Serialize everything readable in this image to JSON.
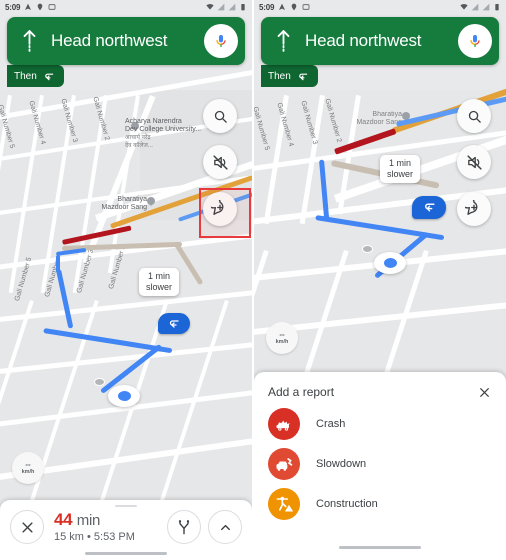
{
  "statusbar": {
    "time": "5:09",
    "left_icons": [
      "navigation-arrow-icon",
      "location-pin-icon",
      "screenshot-icon"
    ],
    "right_icons": [
      "wifi-icon",
      "signal-icon",
      "signal-icon",
      "battery-icon"
    ]
  },
  "nav_header": {
    "direction_icon": "arrow-up-icon",
    "instruction": "Head northwest",
    "mic_icon": "microphone-icon",
    "then_label": "Then",
    "then_icon": "turn-left-icon",
    "green": "#167c3e",
    "then_green": "#0f6631"
  },
  "map_buttons": [
    {
      "name": "search-button",
      "icon": "search-icon"
    },
    {
      "name": "mute-button",
      "icon": "volume-off-icon"
    },
    {
      "name": "add-report-button",
      "icon": "report-bubble-plus-icon"
    }
  ],
  "highlight": {
    "color": "#e8393c",
    "target": "add-report-button"
  },
  "map": {
    "callout": {
      "line1": "1 min",
      "line2": "slower"
    },
    "turn_marker_icon": "u-turn-left-icon",
    "pois": [
      {
        "name": "Acharya Narendra",
        "line2": "Dev College University...",
        "line3": "आचार्य नरेंद्र",
        "line4": "देव कॉलेज..."
      },
      {
        "name": "Bharatiya",
        "line2": "Mazdoor Sang"
      }
    ],
    "streets": [
      "Gali Number 2",
      "Gali Number 3",
      "Gali Number 4",
      "Gali Number 5",
      "Gali Number 2",
      "Gali Number 3",
      "Gali Number 4",
      "Gali Number 5"
    ],
    "route_color": "#4285f4",
    "alt_route_color": "#c9beb2",
    "traffic_red": "#b3151f",
    "traffic_orange": "#e3a13a"
  },
  "speedometer": {
    "value": "--",
    "unit": "km/h"
  },
  "bottom_bar": {
    "close_icon": "close-icon",
    "eta_time": "44",
    "eta_unit": "min",
    "eta_sub": "15 km  •  5:53 PM",
    "routes_icon": "route-alternatives-icon",
    "expand_icon": "chevron-up-icon",
    "eta_color": "#d93025"
  },
  "report_sheet": {
    "title": "Add a report",
    "close_icon": "close-icon",
    "items": [
      {
        "label": "Crash",
        "icon": "crash-icon",
        "color": "#d93025"
      },
      {
        "label": "Slowdown",
        "icon": "slowdown-icon",
        "color": "#e04a33"
      },
      {
        "label": "Construction",
        "icon": "construction-icon",
        "color": "#f09300"
      }
    ]
  }
}
